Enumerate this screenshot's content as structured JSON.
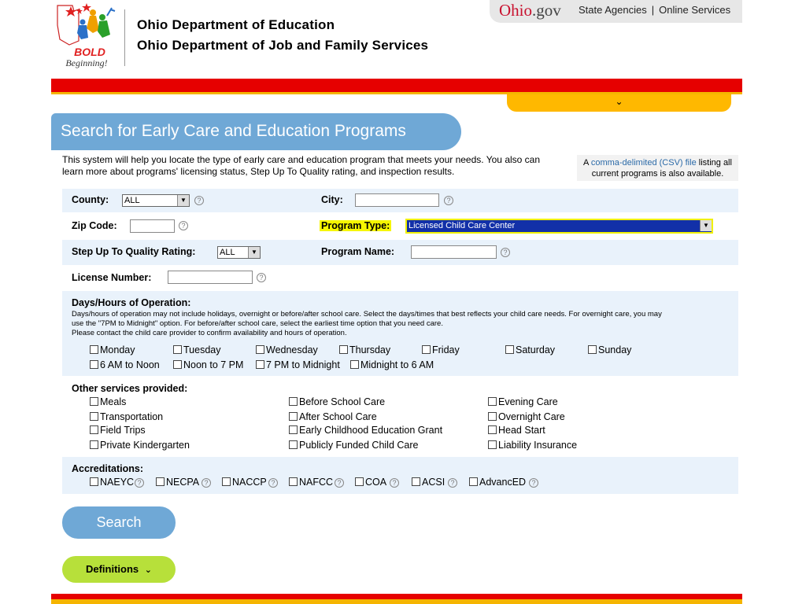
{
  "header": {
    "logo_text1": "BOLD",
    "logo_text2": "Beginning!",
    "agency1": "Ohio Department of Education",
    "agency2": "Ohio Department of Job and Family Services"
  },
  "ohio_bar": {
    "brand_prefix": "Ohio",
    "brand_suffix": ".gov",
    "link1": "State Agencies",
    "separator": "|",
    "link2": "Online Services"
  },
  "menu_toggle": "⌄",
  "page_title": "Search for Early Care and Education Programs",
  "intro": "This system will help you locate the type of early care and education program that meets your needs. You also can learn more about programs' licensing status, Step Up To Quality rating, and inspection results.",
  "csv_box": {
    "pre": "A ",
    "link": "comma-delimited (CSV) file",
    "post": " listing all current programs is also available."
  },
  "form": {
    "county_label": "County:",
    "county_value": "ALL",
    "city_label": "City:",
    "zip_label": "Zip Code:",
    "program_type_label": "Program Type:",
    "program_type_value": "Licensed Child Care Center",
    "sutq_label": "Step Up To Quality Rating:",
    "sutq_value": "ALL",
    "program_name_label": "Program Name:",
    "license_label": "License Number:",
    "help_glyph": "?"
  },
  "days": {
    "heading": "Days/Hours of Operation:",
    "note1": "Days/hours of operation may not include holidays, overnight or before/after school care. Select the days/times that best reflects your child care needs. For overnight care, you may",
    "note2": "use the \"7PM to Midnight\" option. For before/after school care, select the earliest time option that you need care.",
    "note3": "Please contact the child care provider to confirm availability and hours of operation.",
    "day_items": [
      "Monday",
      "Tuesday",
      "Wednesday",
      "Thursday",
      "Friday",
      "Saturday",
      "Sunday"
    ],
    "time_items": [
      "6 AM to Noon",
      "Noon to 7 PM",
      "7 PM to Midnight",
      "Midnight to 6 AM"
    ]
  },
  "services": {
    "heading": "Other services provided:",
    "col1": [
      "Meals",
      "Transportation",
      "Field Trips",
      "Private Kindergarten"
    ],
    "col2": [
      "Before School Care",
      "After School Care",
      "Early Childhood Education Grant",
      "Publicly Funded Child Care"
    ],
    "col3": [
      "Evening Care",
      "Overnight Care",
      "Head Start",
      "Liability Insurance"
    ]
  },
  "accreditations": {
    "heading": "Accreditations:",
    "items": [
      "NAEYC",
      "NECPA",
      "NACCP",
      "NAFCC",
      "COA",
      "ACSI",
      "AdvancED"
    ]
  },
  "buttons": {
    "search": "Search",
    "definitions": "Definitions",
    "definitions_chevron": "⌄"
  },
  "colors": {
    "primary_blue": "#6fa8d6",
    "red_bar": "#e60000",
    "orange": "#ffb800",
    "green_button": "#b7e03a",
    "row_shade": "#e9f2fb"
  }
}
